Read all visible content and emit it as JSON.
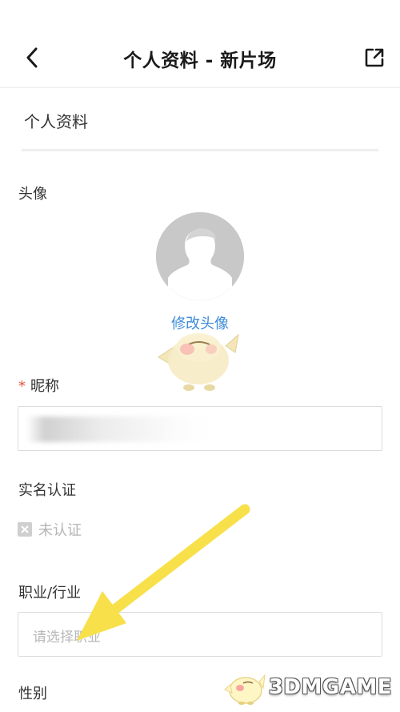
{
  "header": {
    "back_icon": "chevron-left-icon",
    "title": "个人资料 - 新片场",
    "share_icon": "share-external-icon"
  },
  "section": {
    "title": "个人资料"
  },
  "avatar": {
    "label": "头像",
    "change_label": "修改头像",
    "placeholder_icon": "default-avatar-icon"
  },
  "nickname": {
    "required_mark": "*",
    "label": "昵称",
    "value_obscured": true
  },
  "verification": {
    "label": "实名认证",
    "status_icon": "unverified-icon",
    "status": "未认证"
  },
  "occupation": {
    "label": "职业/行业",
    "placeholder": "请选择职业"
  },
  "gender": {
    "label": "性别"
  },
  "annotation": {
    "type": "yellow-arrow",
    "color": "#f7e04a",
    "points_to": "occupation-select"
  },
  "watermark": {
    "text": "3DMGAME"
  },
  "colors": {
    "link": "#3d8bd9",
    "required": "#e4553a",
    "placeholder": "#b8b8b8",
    "border": "#dcdcdc"
  }
}
